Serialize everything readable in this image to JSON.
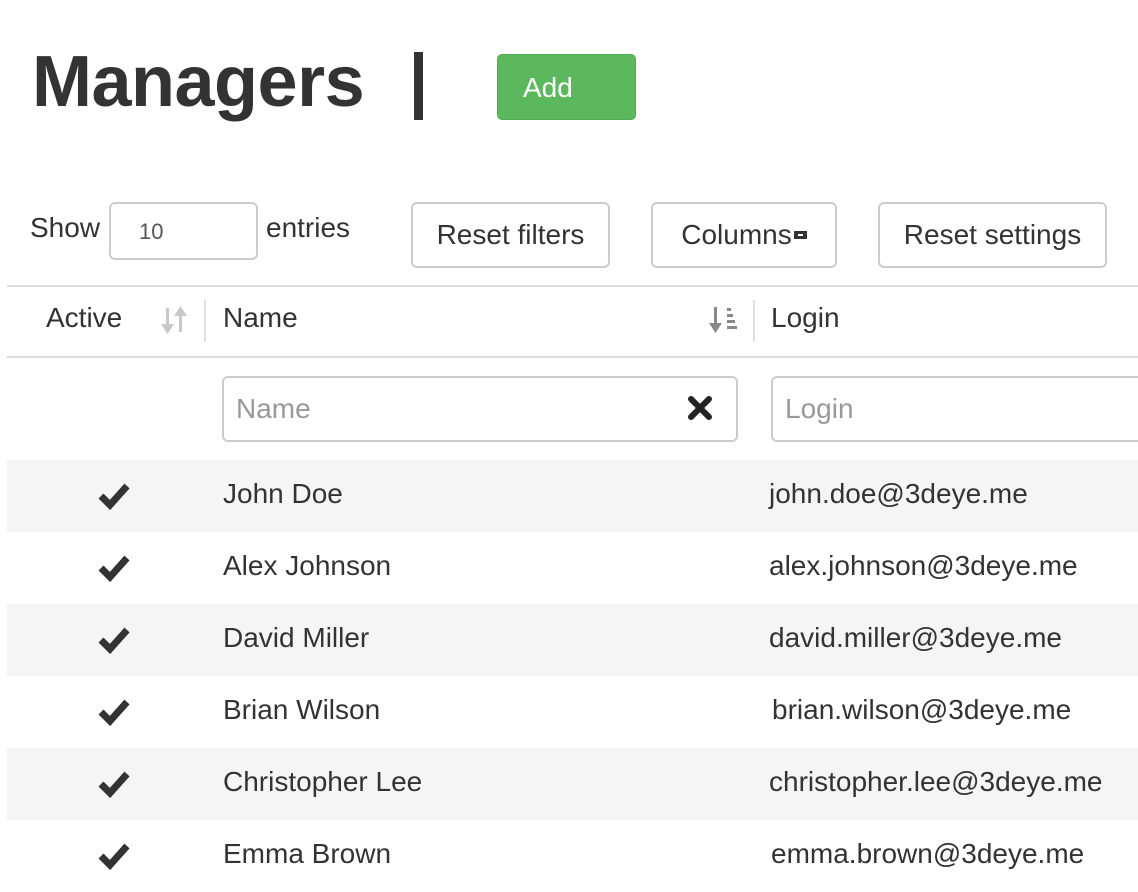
{
  "page": {
    "title": "Managers",
    "add_label": "Add"
  },
  "toolbar": {
    "show_label": "Show",
    "entries_value": "10",
    "entries_label": "entries",
    "reset_filters_label": "Reset filters",
    "columns_label": "Columns",
    "reset_settings_label": "Reset settings"
  },
  "table": {
    "columns": [
      {
        "label": "Active",
        "sort_icon": "sort-both-icon"
      },
      {
        "label": "Name",
        "sort_icon": "sort-alpha-desc-icon"
      },
      {
        "label": "Login",
        "sort_icon": ""
      }
    ],
    "filters": {
      "name_placeholder": "Name",
      "login_placeholder": "Login"
    },
    "rows": [
      {
        "active": true,
        "name": "John Doe",
        "login": "john.doe@3deye.me"
      },
      {
        "active": true,
        "name": "Alex Johnson",
        "login": "alex.johnson@3deye.me"
      },
      {
        "active": true,
        "name": "David Miller",
        "login": "david.miller@3deye.me"
      },
      {
        "active": true,
        "name": "Brian Wilson",
        "login": "brian.wilson@3deye.me"
      },
      {
        "active": true,
        "name": "Christopher Lee",
        "login": "christopher.lee@3deye.me"
      },
      {
        "active": true,
        "name": "Emma Brown",
        "login": "emma.brown@3deye.me"
      }
    ]
  },
  "colors": {
    "accent_green": "#5cb85c",
    "text": "#333333",
    "stripe": "#f5f5f5",
    "border": "#cccccc"
  }
}
